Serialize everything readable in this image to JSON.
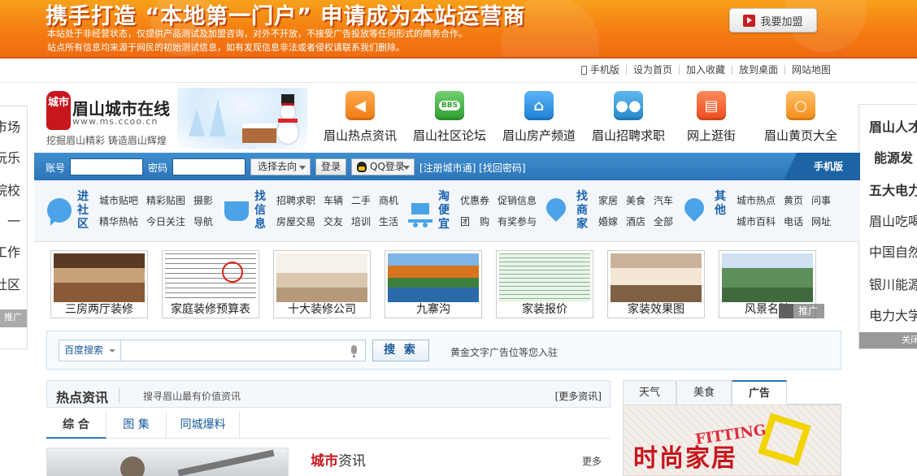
{
  "banner": {
    "title": "携手打造 “本地第一门户” 申请成为本站运营商",
    "line1": "本站处于非经营状态，仅提供产品测试及加盟咨询，对外不开放，不接受广告投放等任何形式的商务合作。",
    "line2": "站点所有信息均来源于网民的初始测试信息，如有发现信息非法或者侵权请联系我们删除。",
    "join_label": "我要加盟"
  },
  "util_links": [
    "手机版",
    "设为首页",
    "加入收藏",
    "放到桌面",
    "网站地图"
  ],
  "side_left": [
    "市场",
    "玩乐",
    "院校",
    "一",
    "工作",
    "社区",
    "推广"
  ],
  "side_right": {
    "items": [
      "眉山人才",
      "能源发",
      "五大电力",
      "眉山吃喝",
      "中国自然",
      "银川能源",
      "电力大学"
    ],
    "footer": "关闭"
  },
  "logo": {
    "mark": "城市",
    "name": "眉山城市在线",
    "url": "www.ms.ccoo.cn",
    "slogan": "挖掘眉山精彩 铸造眉山辉煌"
  },
  "nav_icons": [
    {
      "label": "眉山热点资讯",
      "glyph": "megaphone-icon",
      "color": "orange"
    },
    {
      "label": "眉山社区论坛",
      "glyph": "bbs-icon",
      "color": "green",
      "badge": "BBS"
    },
    {
      "label": "眉山房产频道",
      "glyph": "house-icon",
      "color": "blue"
    },
    {
      "label": "眉山招聘求职",
      "glyph": "people-icon",
      "color": "teal"
    },
    {
      "label": "网上逛街",
      "glyph": "cart-icon",
      "color": "red"
    },
    {
      "label": "眉山黄页大全",
      "glyph": "magnifier-icon",
      "color": "amber"
    }
  ],
  "login": {
    "account_label": "账号",
    "password_label": "密码",
    "goto_select": "选择去向",
    "login_button": "登录",
    "qq_login": "QQ登录",
    "register_links": "[注册城市通] [找回密码]",
    "mobile_tab": "手机版"
  },
  "categories": [
    {
      "title": "进社区",
      "icon": "chat-bubble-icon",
      "rows": [
        [
          "城市贴吧",
          "精彩贴图",
          "摄影"
        ],
        [
          "精华热帖",
          "今日关注",
          "导航"
        ]
      ]
    },
    {
      "title": "找信息",
      "icon": "cup-icon",
      "rows": [
        [
          "招聘求职",
          "车辆",
          "二手",
          "商机"
        ],
        [
          "房屋交易",
          "交友",
          "培训",
          "生活"
        ]
      ]
    },
    {
      "title": "淘便宜",
      "icon": "shopping-cart-icon",
      "rows": [
        [
          "优惠券",
          "促销信息"
        ],
        [
          "团　购",
          "有奖参与"
        ]
      ]
    },
    {
      "title": "找商家",
      "icon": "location-pin-icon",
      "rows": [
        [
          "家居",
          "美食",
          "汽车"
        ],
        [
          "婚嫁",
          "酒店",
          "全部"
        ]
      ]
    },
    {
      "title": "其他",
      "icon": "location-pin-icon",
      "rows": [
        [
          "城市热点",
          "黄页",
          "问事"
        ],
        [
          "城市百科",
          "电话",
          "网址"
        ]
      ]
    }
  ],
  "thumbnails": [
    {
      "caption": "三房两厅装修",
      "style": "room1"
    },
    {
      "caption": "家庭装修预算表",
      "style": "sheet"
    },
    {
      "caption": "十大装修公司",
      "style": "room2"
    },
    {
      "caption": "九寨沟",
      "style": "lake"
    },
    {
      "caption": "家装报价",
      "style": "table"
    },
    {
      "caption": "家装效果图",
      "style": "room3"
    },
    {
      "caption": "风景名胜",
      "style": "mount"
    }
  ],
  "promo_badge": "推广",
  "search": {
    "engine": "百度搜索",
    "placeholder": "",
    "button": "搜 索",
    "ad_text": "黄金文字广告位等您入驻"
  },
  "news": {
    "title": "热点资讯",
    "subtitle": "搜寻眉山最有价值资讯",
    "more": "[更多资讯]",
    "tabs": [
      "综 合",
      "图 集",
      "同城爆料"
    ],
    "city_red": "城市",
    "city_dark": "资讯",
    "city_more": "更多"
  },
  "widget": {
    "tabs": [
      "天气",
      "美食",
      "广告"
    ],
    "ad_big": "时尚家居",
    "ad_fit": "FITTING"
  }
}
